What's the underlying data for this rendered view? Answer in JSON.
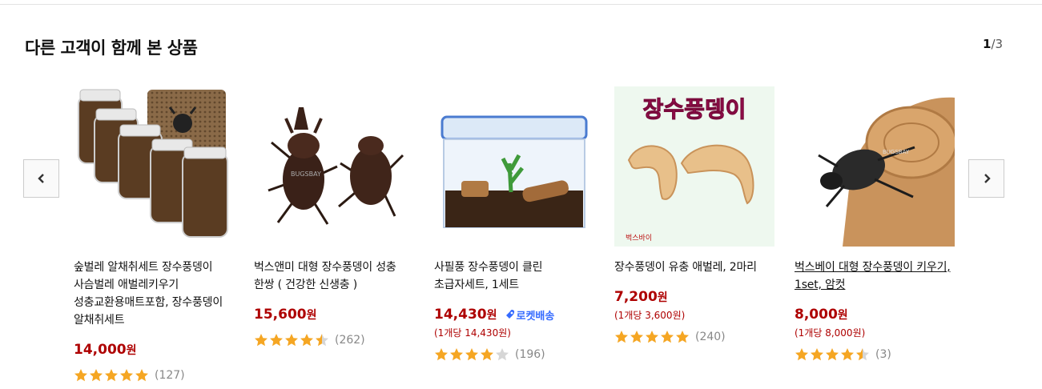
{
  "section": {
    "title": "다른 고객이 함께 본 상품",
    "page_current": "1",
    "page_total": "/3"
  },
  "nav": {
    "prev_icon": "chevron-left-icon",
    "next_icon": "chevron-right-icon"
  },
  "colors": {
    "price": "#ae0000",
    "star": "#f5a623",
    "rocket": "#346aff"
  },
  "products": [
    {
      "name": "숲벌레 알채취세트 장수풍뎅이 사슴벌레 애벌레키우기 성충교환용매트포함, 장수풍뎅이 알채취세트",
      "price": "14,000",
      "won": "원",
      "unit_price": "",
      "rocket_label": "",
      "rating": 5,
      "reviews": "(127)"
    },
    {
      "name": "벅스앤미 대형 장수풍뎅이 성충 한쌍 ( 건강한 신생충 )",
      "price": "15,600",
      "won": "원",
      "unit_price": "",
      "rocket_label": "",
      "rating": 4.5,
      "reviews": "(262)"
    },
    {
      "name": "사필풍 장수풍뎅이 클린 초급자세트, 1세트",
      "price": "14,430",
      "won": "원",
      "unit_price": "(1개당 14,430원)",
      "rocket_label": "로켓배송",
      "rating": 4,
      "reviews": "(196)"
    },
    {
      "name": "장수풍뎅이 유충 애벌레, 2마리",
      "price": "7,200",
      "won": "원",
      "unit_price": "(1개당 3,600원)",
      "rocket_label": "",
      "rating": 5,
      "reviews": "(240)"
    },
    {
      "name": "벅스베이 대형 장수풍뎅이 키우기, 1set, 암컷",
      "price": "8,000",
      "won": "원",
      "unit_price": "(1개당 8,000원)",
      "rocket_label": "",
      "rating": 4.5,
      "reviews": "(3)"
    }
  ],
  "images": {
    "p4_banner": "장수풍뎅이",
    "p4_brand": "벅스바이",
    "p2_watermark": "BUGSBAY",
    "p5_watermark": "BUGSBAY"
  }
}
